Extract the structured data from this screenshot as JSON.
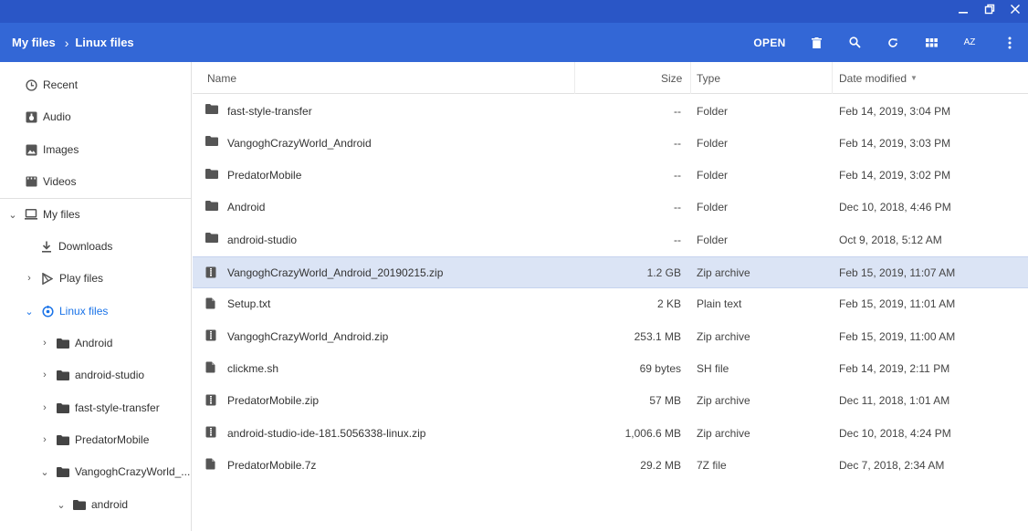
{
  "window": {
    "controls": [
      "minimize-icon",
      "restore-icon",
      "close-icon"
    ]
  },
  "breadcrumb": {
    "root": "My files",
    "current": "Linux files"
  },
  "toolbar": {
    "open_label": "OPEN",
    "sort_label": "AZ"
  },
  "sidebar": {
    "recent": "Recent",
    "audio": "Audio",
    "images": "Images",
    "videos": "Videos",
    "my_files": "My files",
    "downloads": "Downloads",
    "play_files": "Play files",
    "linux_files": "Linux files",
    "linux_children": [
      "Android",
      "android-studio",
      "fast-style-transfer",
      "PredatorMobile",
      "VangoghCrazyWorld_..."
    ],
    "android": "android"
  },
  "columns": {
    "name": "Name",
    "size": "Size",
    "type": "Type",
    "date": "Date modified"
  },
  "files": [
    {
      "name": "fast-style-transfer",
      "size": "--",
      "type": "Folder",
      "date": "Feb 14, 2019, 3:04 PM",
      "kind": "folder"
    },
    {
      "name": "VangoghCrazyWorld_Android",
      "size": "--",
      "type": "Folder",
      "date": "Feb 14, 2019, 3:03 PM",
      "kind": "folder"
    },
    {
      "name": "PredatorMobile",
      "size": "--",
      "type": "Folder",
      "date": "Feb 14, 2019, 3:02 PM",
      "kind": "folder"
    },
    {
      "name": "Android",
      "size": "--",
      "type": "Folder",
      "date": "Dec 10, 2018, 4:46 PM",
      "kind": "folder"
    },
    {
      "name": "android-studio",
      "size": "--",
      "type": "Folder",
      "date": "Oct 9, 2018, 5:12 AM",
      "kind": "folder"
    },
    {
      "name": "VangoghCrazyWorld_Android_20190215.zip",
      "size": "1.2 GB",
      "type": "Zip archive",
      "date": "Feb 15, 2019, 11:07 AM",
      "kind": "zip",
      "selected": true
    },
    {
      "name": "Setup.txt",
      "size": "2 KB",
      "type": "Plain text",
      "date": "Feb 15, 2019, 11:01 AM",
      "kind": "file"
    },
    {
      "name": "VangoghCrazyWorld_Android.zip",
      "size": "253.1 MB",
      "type": "Zip archive",
      "date": "Feb 15, 2019, 11:00 AM",
      "kind": "zip"
    },
    {
      "name": "clickme.sh",
      "size": "69 bytes",
      "type": "SH file",
      "date": "Feb 14, 2019, 2:11 PM",
      "kind": "file"
    },
    {
      "name": "PredatorMobile.zip",
      "size": "57 MB",
      "type": "Zip archive",
      "date": "Dec 11, 2018, 1:01 AM",
      "kind": "zip"
    },
    {
      "name": "android-studio-ide-181.5056338-linux.zip",
      "size": "1,006.6 MB",
      "type": "Zip archive",
      "date": "Dec 10, 2018, 4:24 PM",
      "kind": "zip"
    },
    {
      "name": "PredatorMobile.7z",
      "size": "29.2 MB",
      "type": "7Z file",
      "date": "Dec 7, 2018, 2:34 AM",
      "kind": "file"
    }
  ]
}
